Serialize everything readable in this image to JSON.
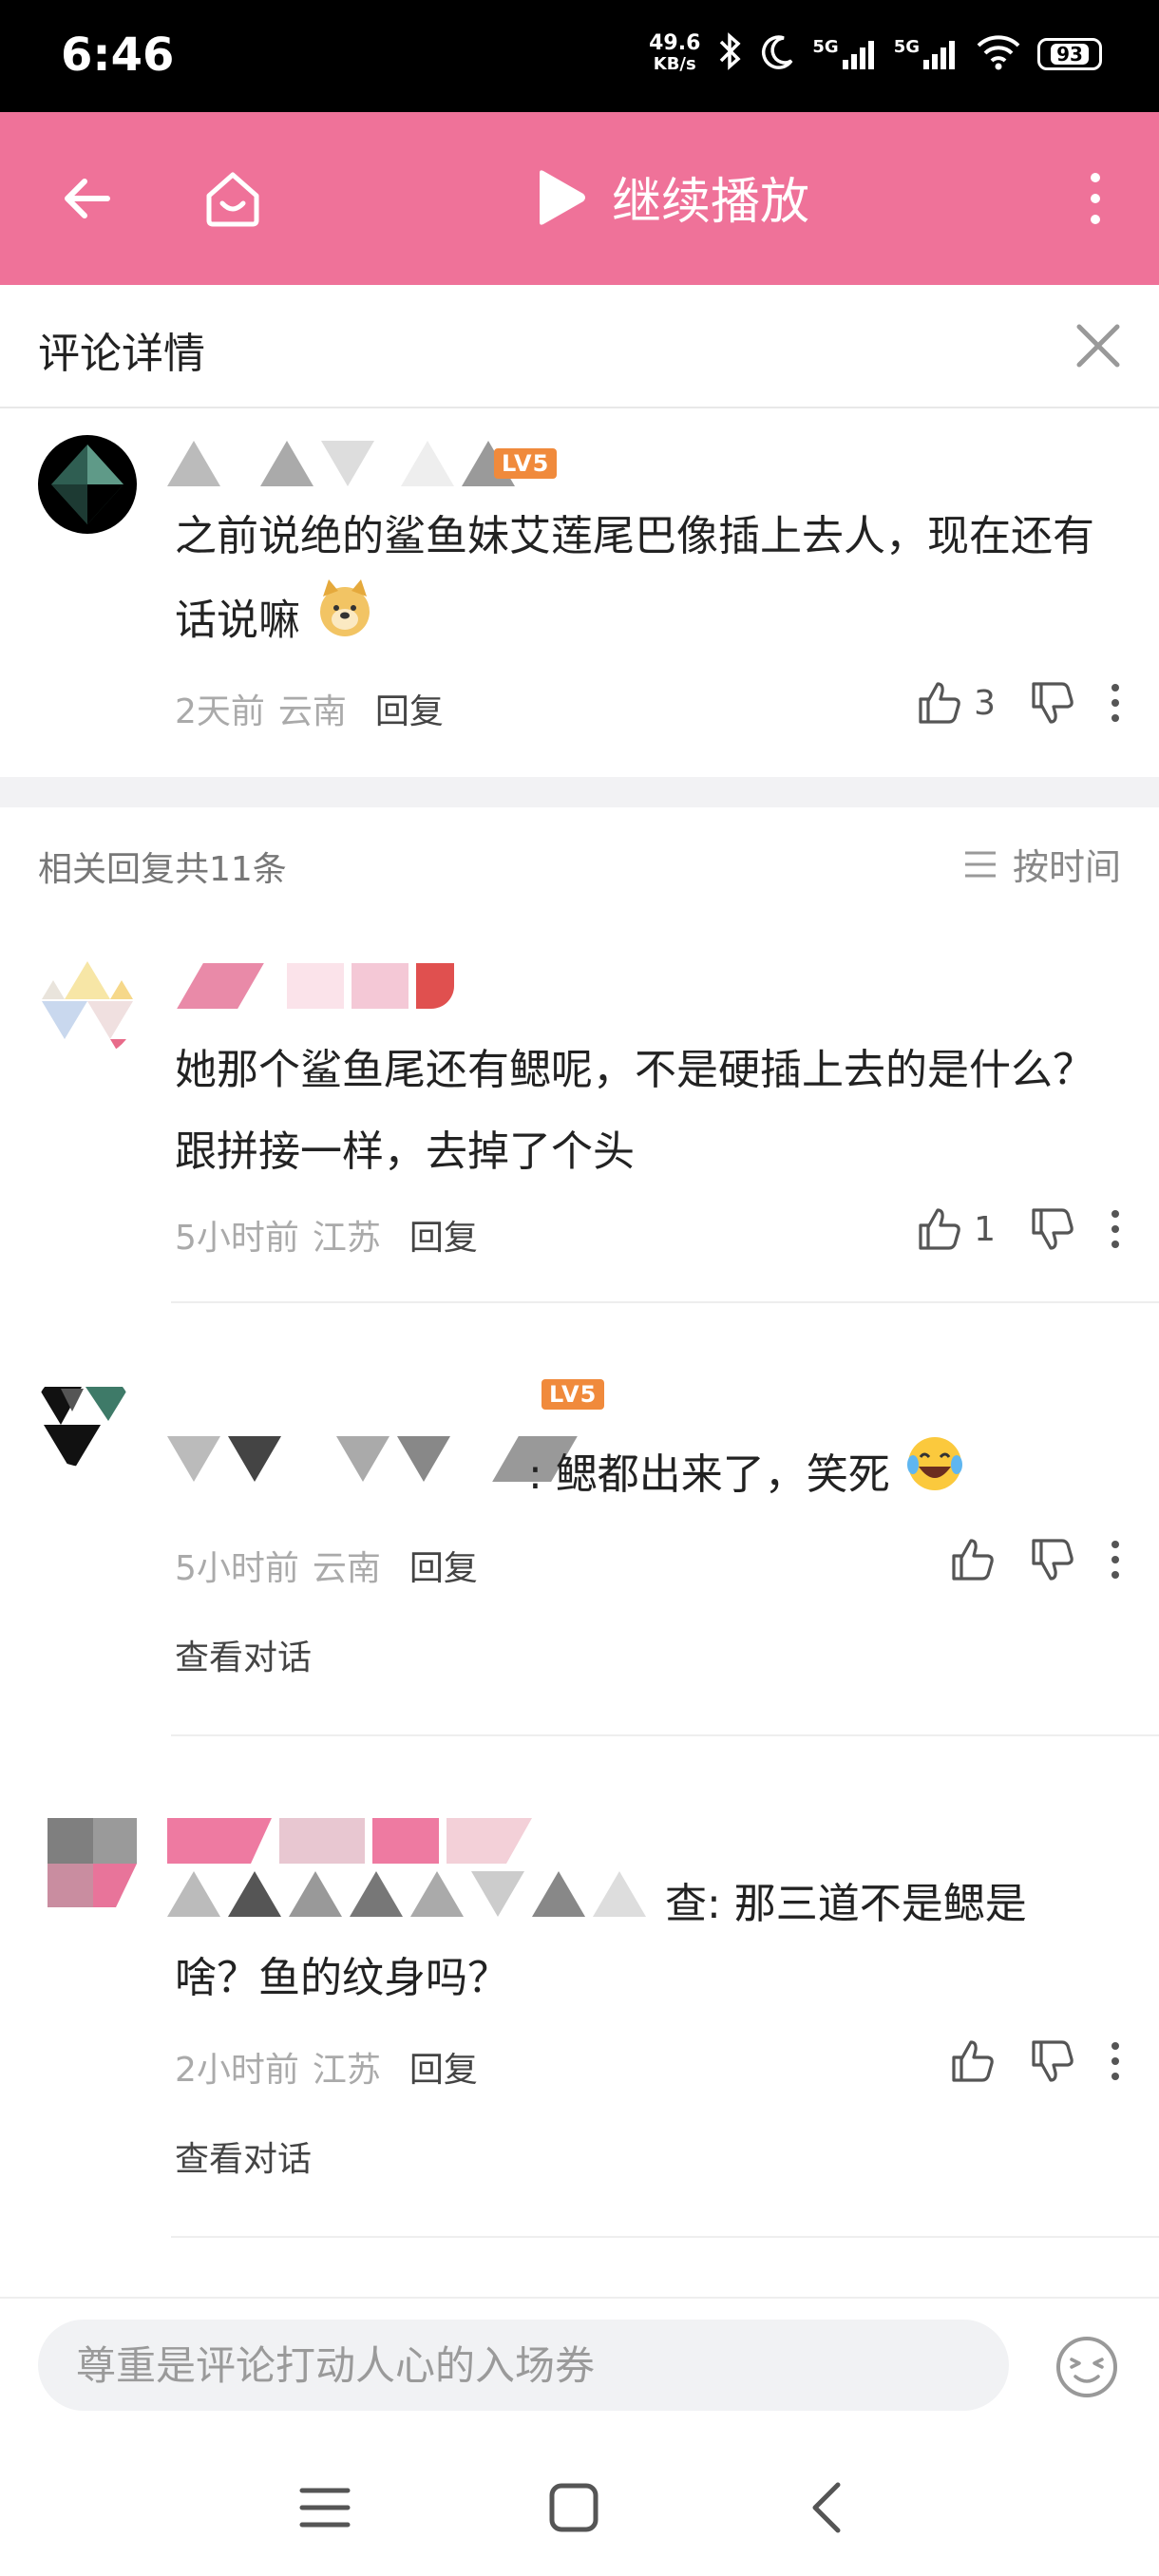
{
  "status_bar": {
    "time": "6:46",
    "net_speed_value": "49.6",
    "net_speed_unit": "KB/s",
    "signal1": "5G",
    "signal2": "5G",
    "battery": "93"
  },
  "app_bar": {
    "continue_label": "继续播放",
    "bg_color": "#ef7299"
  },
  "detail_header": {
    "title": "评论详情"
  },
  "main_comment": {
    "level": "LV5",
    "text": "之前说绝的鲨鱼妹艾莲尾巴像插上去人，现在还有话说嘛",
    "time": "2天前",
    "location": "云南",
    "reply_label": "回复",
    "likes": "3"
  },
  "related": {
    "count_label": "相关回复共11条",
    "sort_label": "按时间"
  },
  "replies": [
    {
      "text": "她那个鲨鱼尾还有鳃呢，不是硬插上去的是什么？跟拼接一样，去掉了个头",
      "time": "5小时前",
      "location": "江苏",
      "reply_label": "回复",
      "likes": "1"
    },
    {
      "level": "LV5",
      "text": ": 鳃都出来了，笑死",
      "time": "5小时前",
      "location": "云南",
      "reply_label": "回复",
      "view_dialog": "查看对话"
    },
    {
      "text_line1": "查: 那三道不是鳃是",
      "text_line2": "啥？鱼的纹身吗？",
      "time": "2小时前",
      "location": "江苏",
      "reply_label": "回复",
      "view_dialog": "查看对话"
    }
  ],
  "input_bar": {
    "placeholder": "尊重是评论打动人心的入场券"
  }
}
